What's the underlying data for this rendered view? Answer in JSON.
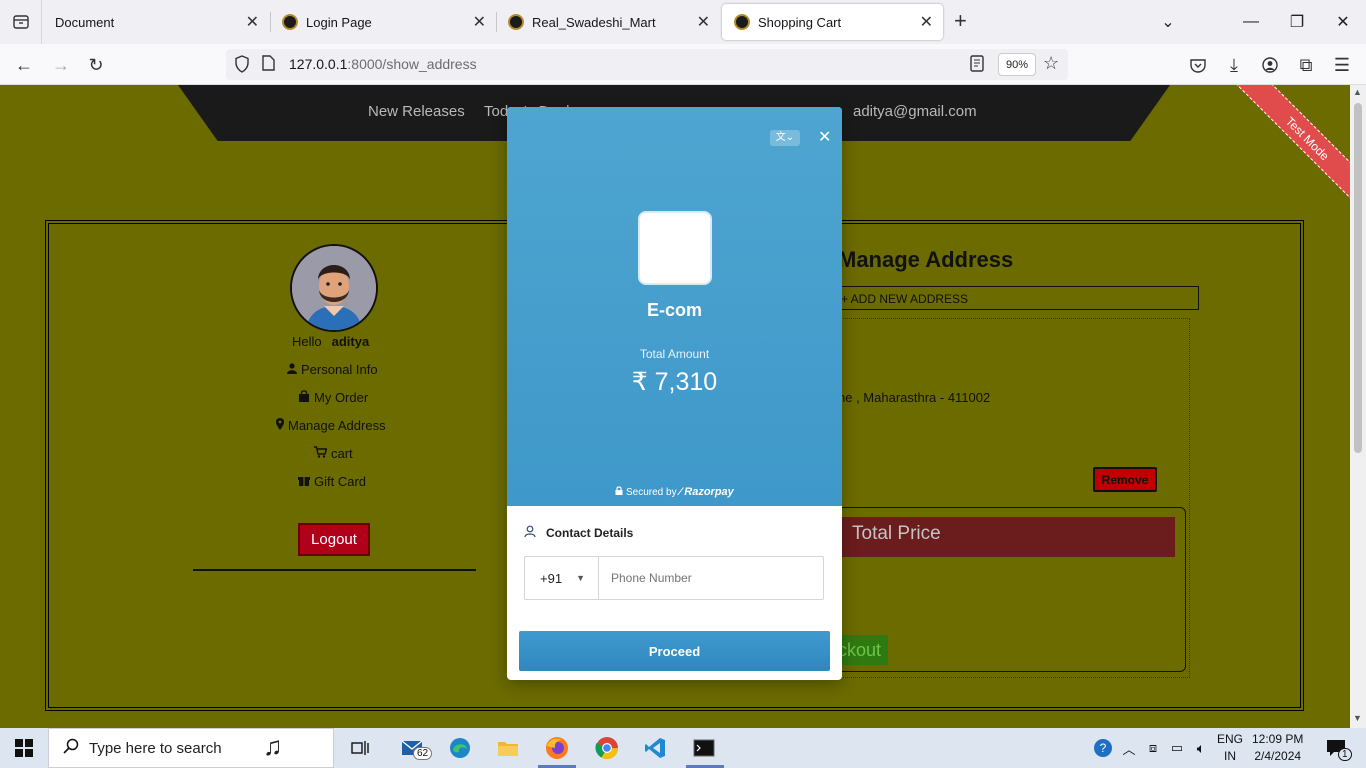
{
  "browser": {
    "tabs": [
      {
        "title": "Document"
      },
      {
        "title": "Login Page"
      },
      {
        "title": "Real_Swadeshi_Mart"
      },
      {
        "title": "Shopping Cart"
      }
    ],
    "url_host": "127.0.0.1",
    "url_rest": ":8000/show_address",
    "zoom": "90%"
  },
  "site": {
    "nav": [
      "New Releases",
      "Today's Deals",
      "aditya@gmail.com"
    ],
    "ribbon": "Test Mode",
    "sidebar": {
      "hello": "Hello",
      "username": "aditya",
      "links": [
        "Personal Info",
        "My Order",
        "Manage Address",
        "cart",
        "Gift Card"
      ],
      "logout": "Logout"
    },
    "main": {
      "title": "Manage Address",
      "add_address": "+ ADD NEW ADDRESS",
      "address": "ne , Maharasthra - 411002",
      "remove": "Remove",
      "total_price": "Total Price",
      "checkout": "ckout"
    }
  },
  "modal": {
    "merchant": "E-com",
    "amount_label": "Total Amount",
    "amount": "₹ 7,310",
    "secured_by": "Secured by",
    "brand": "Razorpay",
    "contact_title": "Contact Details",
    "country_code": "+91",
    "phone_placeholder": "Phone Number",
    "proceed": "Proceed"
  },
  "taskbar": {
    "search_placeholder": "Type here to search",
    "mail_badge": "62",
    "lang_top": "ENG",
    "lang_bottom": "IN",
    "time": "12:09 PM",
    "date": "2/4/2024",
    "notif_count": "1"
  }
}
